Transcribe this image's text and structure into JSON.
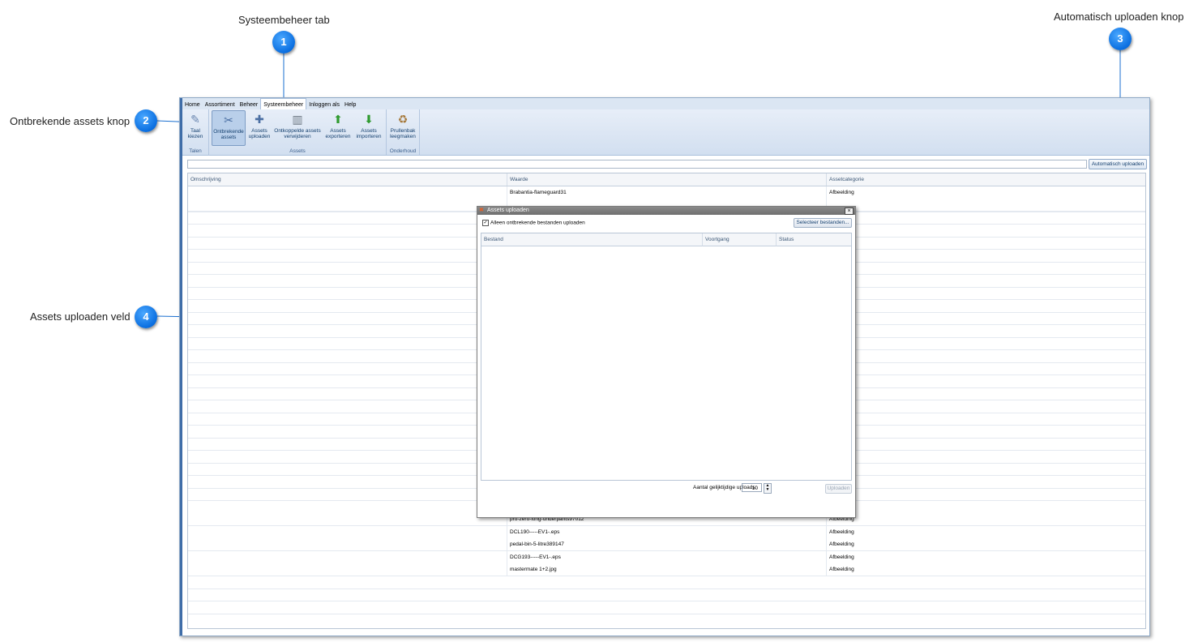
{
  "callouts": [
    {
      "number": "1",
      "label": "Systeembeheer tab"
    },
    {
      "number": "2",
      "label": "Ontbrekende assets knop"
    },
    {
      "number": "3",
      "label": "Automatisch uploaden knop"
    },
    {
      "number": "4",
      "label": "Assets uploaden veld"
    }
  ],
  "menu": [
    "Home",
    "Assortiment",
    "Beheer",
    "Systeembeheer",
    "Inloggen als",
    "Help"
  ],
  "ribbon": {
    "groups": [
      "Talen",
      "Assets",
      "Onderhoud"
    ],
    "buttons": [
      {
        "label": "Taal kiezen",
        "icon": "language-icon"
      },
      {
        "label": "Ontbrekende assets",
        "icon": "missing-assets-icon"
      },
      {
        "label": "Assets uploaden",
        "icon": "upload-assets-icon"
      },
      {
        "label": "Ontkoppelde assets verwijderen",
        "icon": "delete-unlinked-icon"
      },
      {
        "label": "Assets exporteren",
        "icon": "export-icon"
      },
      {
        "label": "Assets importeren",
        "icon": "import-icon"
      },
      {
        "label": "Prullenbak leegmaken",
        "icon": "recycle-bin-icon"
      }
    ]
  },
  "toolbar": {
    "auto_upload_label": "Automatisch uploaden"
  },
  "grid": {
    "columns": [
      "Omschrijving",
      "Waarde",
      "Assetcategorie"
    ],
    "rows": [
      {
        "waarde": "Brabantia-flameguard31",
        "categorie": "Afbeelding"
      },
      {
        "waarde": "",
        "categorie": ""
      },
      {
        "waarde": "pro-zero-long-underpants97012",
        "categorie": "Afbeelding"
      },
      {
        "waarde": "DCL190-----EV1-.eps",
        "categorie": "Afbeelding"
      },
      {
        "waarde": "pedal-bin-5-litre389147",
        "categorie": "Afbeelding"
      },
      {
        "waarde": "DCG193-----EV1-.eps",
        "categorie": "Afbeelding"
      },
      {
        "waarde": "mastermate 1+2.jpg",
        "categorie": "Afbeelding"
      }
    ]
  },
  "dialog": {
    "title": "Assets uploaden",
    "checkbox_label": "Alleen ontbrekende bestanden uploaden",
    "select_files_label": "Selecteer bestanden...",
    "columns": [
      "Bestand",
      "Voortgang",
      "Status"
    ],
    "concurrent_label": "Aantal gelijktijdige uploads:",
    "concurrent_value": "10",
    "upload_label": "Uploaden"
  }
}
